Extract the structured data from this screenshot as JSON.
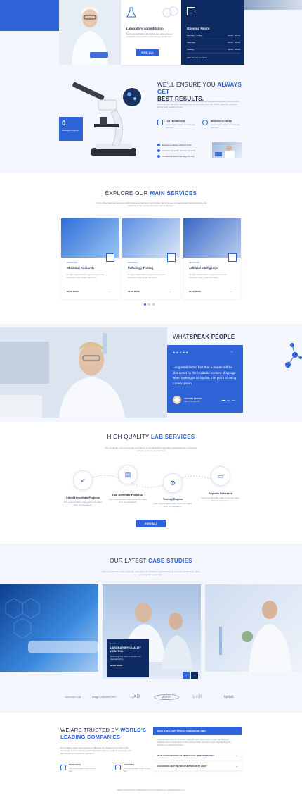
{
  "top": {
    "accreditation_title": "Laboratory accreditation",
    "accreditation_text": "Sed ut perspiciatis unde omnis iste natus error sit voluptatem accusantium doloremque laudantium",
    "view_all": "VIEW ALL",
    "hours_title": "Opening Hours",
    "hours": [
      {
        "day": "Monday – Friday",
        "time": "09:00 - 18:00"
      },
      {
        "day": "Saturday",
        "time": "09:00 - 16:00"
      },
      {
        "day": "Sunday",
        "time": "10:00 - 16:00"
      }
    ],
    "hours_note": "24/7 Service available"
  },
  "ensure": {
    "title_plain": "WE'LL ENSURE YOU",
    "title_bold_1": "ALWAYS GET",
    "title_bold_2": "BEST RESULTS.",
    "text": "Lorem Ipsum is simply dummy text of the printing and typesetting industry. Lorem Ipsum has been the industry's standard dummy text ever since the 1500s, when an unknown printer took a galley of type.",
    "counter_value": "0",
    "counter_label": "Awarded Projects",
    "features": [
      {
        "title": "LAB TECHNICIANS",
        "text": "Lorem Ipsum dolor sit amet con sec tetur."
      },
      {
        "title": "RESEARCH CENTER",
        "text": "Lorem Ipsum dolor sit amet con sec tetur."
      }
    ],
    "checks": [
      "Exploring seldom efficient Pride",
      "Ancestor acquaint pensive contents",
      "Consequat ipsum nec seg fritz fuit."
    ]
  },
  "services": {
    "title_plain": "EXPLORE OUR",
    "title_bold": "MAIN SERVICES",
    "subtitle": "On the other hand we denounce with righteous indignation and dislike men who are so beguiled and demoralized by the pleasure of the moment that they cannot foresee.",
    "cards": [
      {
        "tag": "RADIOLOGY",
        "title": "Chemical Research",
        "text": "To help stakeholders in government and business make smart decisions.",
        "link": "READ MORE"
      },
      {
        "tag": "BIOSAFETY",
        "title": "Pathology Testing",
        "text": "To help stakeholders in government and business make smart decisions.",
        "link": "READ MORE"
      },
      {
        "tag": "PATHOLOGY",
        "title": "Artificial Intelligence",
        "text": "To help stakeholders in government and business make smart decisions.",
        "link": "READ MORE"
      }
    ]
  },
  "testimonial": {
    "title_plain": "WHAT",
    "title_bold": "SPEAK PEOPLE",
    "quote": "Long established fact that a reader will be distracted by the readable content of a page when looking at its layout. The point of using Lorem Ipsum",
    "name": "VICTORIA PORTER",
    "role": "CEO at Google INC"
  },
  "lab": {
    "title_plain": "HIGH QUALITY",
    "title_bold": "LAB SERVICES",
    "subtitle": "We are all the main buyers and operations of controlled lines that have researched with engineers, ready to serve you at their best.",
    "steps": [
      {
        "title": "Client Describes Projects",
        "text": "Sed ut perspiciatis unde omnis iste natus error sit voluptatem."
      },
      {
        "title": "Lab Generate Proposal",
        "text": "Sed ut perspiciatis unde omnis iste natus error sit voluptatem."
      },
      {
        "title": "Testing Begins",
        "text": "Sed ut perspiciatis unde omnis iste natus error sit voluptatem."
      },
      {
        "title": "Reports Delivered",
        "text": "Sed ut perspiciatis unde omnis iste natus error sit voluptatem."
      }
    ],
    "button": "VIEW ALL"
  },
  "cases": {
    "title_plain": "OUR LATEST",
    "title_bold": "CASE STUDIES",
    "subtitle": "Sed ut perspiciatis unde omnis iste natus error sit voluptatem accusantium do loremque laudantium, totam rem aperiam eaque ipsa.",
    "overlay_tag": "Chemistry",
    "overlay_title": "LABORATORY QUALITY CONTROL",
    "overlay_text": "Enhancing Your Vision on another son label adipisicing",
    "overlay_link": "READ MORE"
  },
  "logos": [
    "INDUSTRY LAB",
    "design LABORATORY",
    "LAB",
    "planet",
    "LAB",
    "funlab"
  ],
  "trusted": {
    "title_plain_1": "WE ARE TRUSTED BY",
    "title_bold_1": "WORLD'S",
    "title_bold_2": "LEADING COMPANIES",
    "text": "Every fallen credit-name coverage, laborate lab studies in a lot like to the contribute, tech it interacting with laboratory science, ready to serve you and laboratories is to serve the research.",
    "items": [
      {
        "title": "RESEARCH",
        "text": "Sed perspiciatis unde omnis iste"
      },
      {
        "title": "VACCINES",
        "text": "Sed perspiciatis unde omnis iste"
      }
    ],
    "faq": [
      {
        "q": "WHAT IS THE LAB'S TYPICAL TURNAROUND TIME?",
        "a": "Laboratories exist for scientific research, they have many Lorem the differing requirements of specialists in the various fields of science and engineering with laboratory particle activation."
      },
      {
        "q": "WHAT CATEGORY DOES MY PRODUCT FALL INTO FOR MY PAY?",
        "a": ""
      },
      {
        "q": "CAN SEARCH HELP ME FIND OTHER SPECIALTY LABS?",
        "a": ""
      }
    ]
  },
  "footer_text": "Need research for Every Patient Every Time or contact us at support@example.com"
}
